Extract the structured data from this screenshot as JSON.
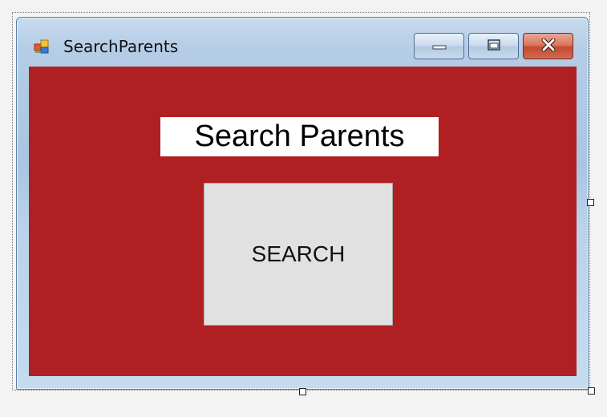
{
  "window": {
    "title": "SearchParents",
    "icon": "windows-form-icon"
  },
  "caption_buttons": {
    "minimize": "minimize-icon",
    "maximize": "maximize-icon",
    "close": "close-icon"
  },
  "form": {
    "background_color": "#b01f22",
    "heading": "Search Parents",
    "search_button_label": "SEARCH"
  }
}
